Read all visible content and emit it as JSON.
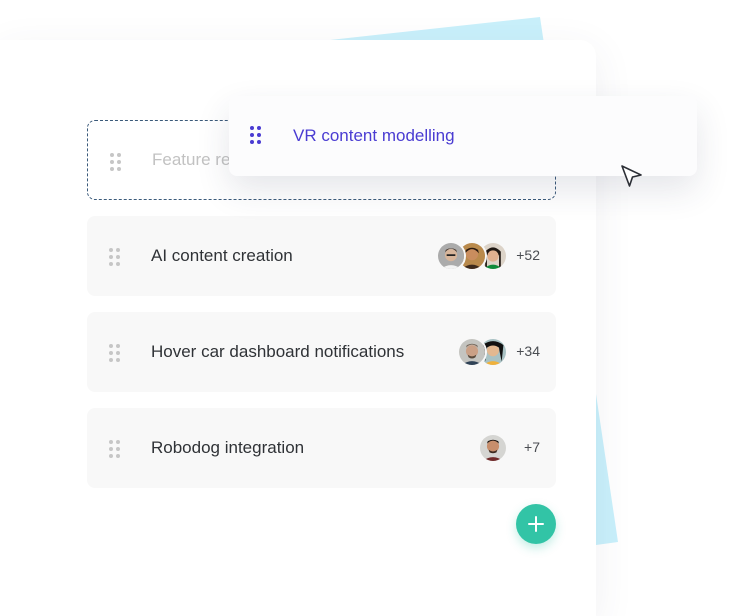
{
  "colors": {
    "accent": "#4a3cd2",
    "fab": "#32c4a6",
    "decor_blue": "#c9f0fb"
  },
  "placeholder_card": {
    "title": "Feature re"
  },
  "dragged_card": {
    "title": "VR content modelling"
  },
  "cards": [
    {
      "title": "AI content creation",
      "count": "+52"
    },
    {
      "title": "Hover car dashboard notifications",
      "count": "+34"
    },
    {
      "title": "Robodog integration",
      "count": "+7"
    }
  ],
  "icons": {
    "grip": "drag-handle-icon",
    "cursor": "cursor-arrow-icon",
    "fab": "plus-icon"
  }
}
